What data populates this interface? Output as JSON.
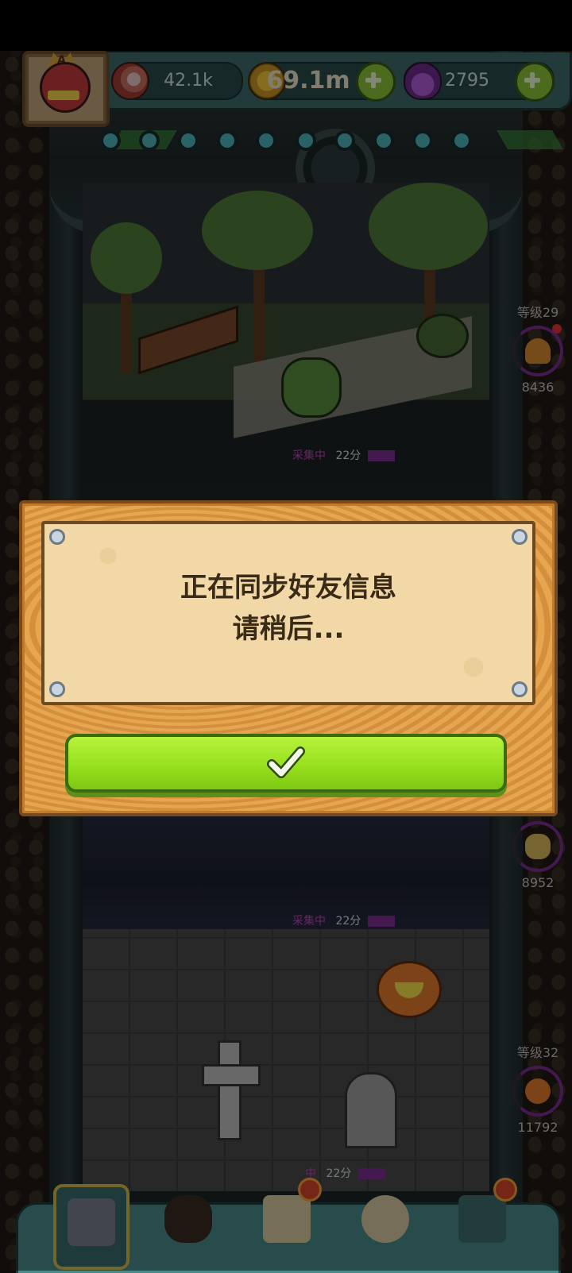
{
  "hud": {
    "eyes": "42.1k",
    "coins": "69.1m",
    "potions": "2795",
    "avatar_letter": "A"
  },
  "floors": [
    {
      "id": "garden",
      "status_label": "采集中",
      "time": "22分"
    },
    {
      "id": "crypt-upper",
      "status_label": "采集中",
      "time": "22分"
    },
    {
      "id": "crypt",
      "status_label": "中",
      "time": "22分"
    }
  ],
  "side": [
    {
      "level": "等级29",
      "count": "8436",
      "icon": "mushroom-icon"
    },
    {
      "level": "",
      "count": "8952",
      "icon": "corn-icon"
    },
    {
      "level": "等级32",
      "count": "11792",
      "icon": "pumpkin-icon"
    }
  ],
  "dialog": {
    "line1": "正在同步好友信息",
    "line2": "请稍后...",
    "confirm_icon": "check-icon"
  },
  "bottom_nav": [
    {
      "name": "tower",
      "icon": "tower-icon",
      "selected": true
    },
    {
      "name": "monsters",
      "icon": "monster-icon",
      "selected": false
    },
    {
      "name": "book",
      "icon": "book-icon",
      "selected": false,
      "badge": true
    },
    {
      "name": "bag",
      "icon": "coin-bag-icon",
      "selected": false
    },
    {
      "name": "friends",
      "icon": "friends-icon",
      "selected": false,
      "badge": true
    }
  ]
}
